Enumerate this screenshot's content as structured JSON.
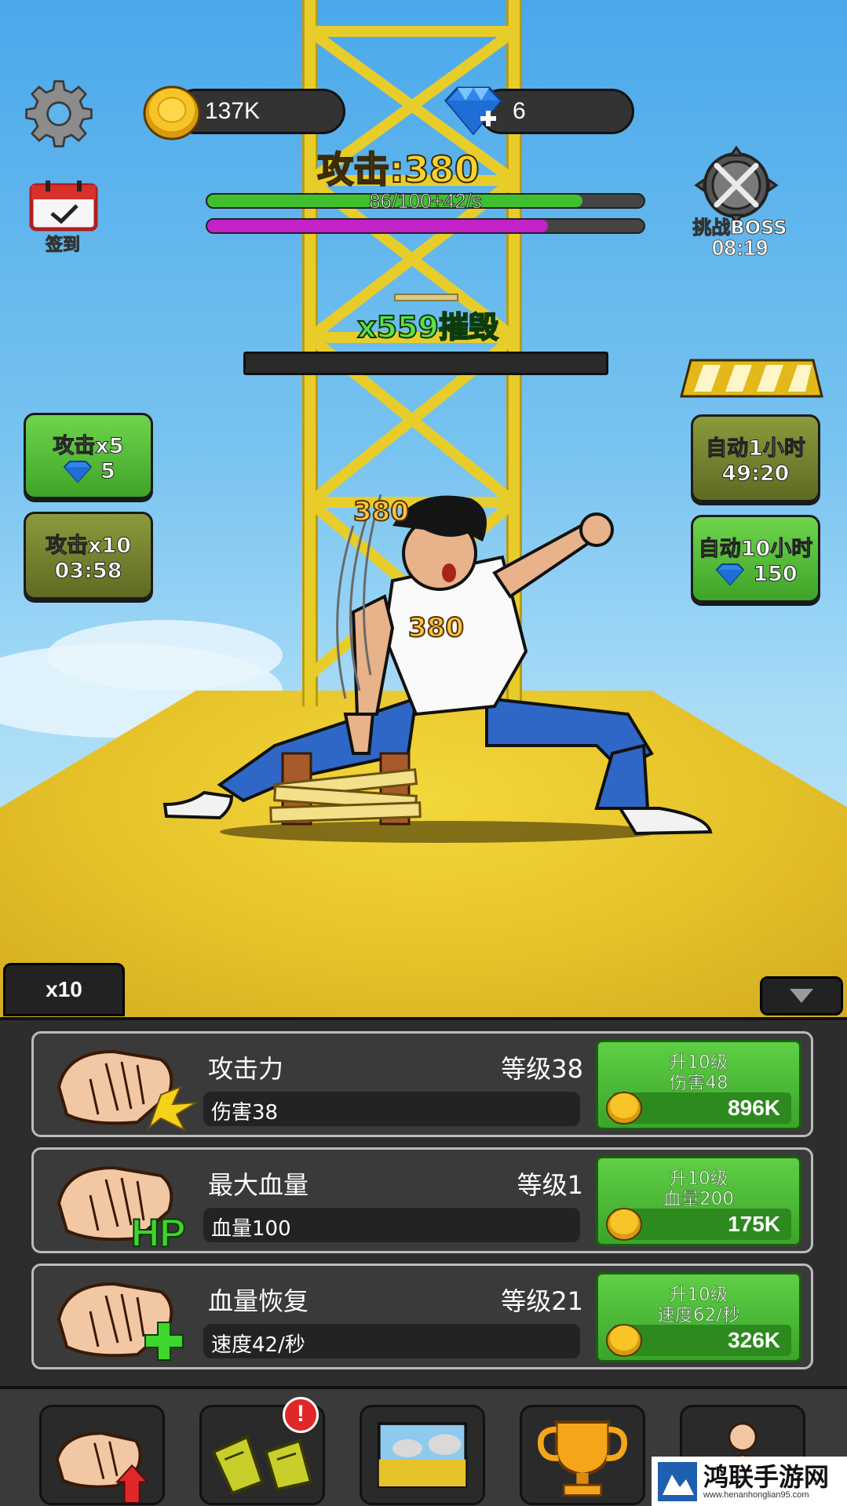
{
  "hud": {
    "coins": "137K",
    "gems": "6",
    "attack_label": "攻击:380",
    "hp_text": "86/100+42/s",
    "hp_fraction": 0.86,
    "power_fraction": 0.78,
    "signin_label": "签到",
    "boss_label": "挑战BOSS",
    "boss_timer": "08:19"
  },
  "combat": {
    "destroy_text": "x559摧毁",
    "damage_1": "380",
    "damage_2": "380"
  },
  "side_left": [
    {
      "label": "攻击x5",
      "sub": "5",
      "sub_type": "gem"
    },
    {
      "label": "攻击x10",
      "sub": "03:58",
      "sub_type": "timer"
    }
  ],
  "side_right": [
    {
      "label": "自动1小时",
      "sub": "49:20",
      "sub_type": "timer"
    },
    {
      "label": "自动10小时",
      "sub": "150",
      "sub_type": "gem"
    }
  ],
  "multiplier_tab": "x10",
  "upgrades": [
    {
      "name": "攻击力",
      "level": "等级38",
      "stat": "伤害38",
      "btn_line1": "升10级",
      "btn_line2": "伤害48",
      "price": "896K",
      "icon": "fist-impact-icon"
    },
    {
      "name": "最大血量",
      "level": "等级1",
      "stat": "血量100",
      "btn_line1": "升10级",
      "btn_line2": "血量200",
      "price": "175K",
      "icon": "fist-hp-icon"
    },
    {
      "name": "血量恢复",
      "level": "等级21",
      "stat": "速度42/秒",
      "btn_line1": "升10级",
      "btn_line2": "速度62/秒",
      "price": "326K",
      "icon": "fist-heal-icon"
    }
  ],
  "nav": {
    "items": [
      "fist-upgrade-icon",
      "broken-planks-icon",
      "scene-map-icon",
      "trophy-icon",
      "character-icon"
    ],
    "alert": "!"
  },
  "watermark": {
    "title": "鸿联手游网",
    "url": "www.henanhonglian95.com"
  },
  "colors": {
    "hp": "#3fbf2e",
    "power": "#c322c9",
    "button_green": "#4cbf36",
    "panel": "#2d2d2d",
    "sky": "#5fb4e8",
    "ground": "#e6c22a"
  }
}
